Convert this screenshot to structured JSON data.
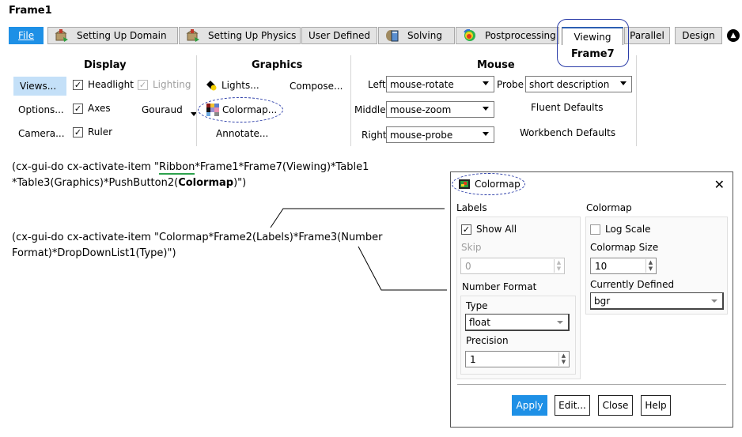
{
  "frame_title": "Frame1",
  "tabs": [
    {
      "label": "File",
      "icon": null
    },
    {
      "label": "Setting Up Domain",
      "icon": "setup-box-icon"
    },
    {
      "label": "Setting Up Physics",
      "icon": "setup-box-icon"
    },
    {
      "label": "User Defined",
      "icon": null
    },
    {
      "label": "Solving",
      "icon": "calculator-icon"
    },
    {
      "label": "Postprocessing",
      "icon": "contour-sphere-icon"
    },
    {
      "label": "Viewing",
      "icon": null,
      "active": true
    },
    {
      "label": "Parallel",
      "icon": null
    },
    {
      "label": "Design",
      "icon": null
    }
  ],
  "annotation_frame7": "Frame7",
  "ribbon": {
    "display": {
      "title": "Display",
      "buttons": [
        "Views...",
        "Options...",
        "Camera..."
      ],
      "checkboxes": [
        {
          "label": "Headlight",
          "checked": true,
          "enabled": true
        },
        {
          "label": "Lighting",
          "checked": true,
          "enabled": false
        },
        {
          "label": "Axes",
          "checked": true,
          "enabled": true
        },
        {
          "label": "Ruler",
          "checked": true,
          "enabled": true
        }
      ],
      "shading": "Gouraud"
    },
    "graphics": {
      "title": "Graphics",
      "buttons": [
        "Lights...",
        "Compose...",
        "Colormap...",
        "Annotate..."
      ]
    },
    "mouse": {
      "title": "Mouse",
      "left_label": "Left",
      "left_value": "mouse-rotate",
      "middle_label": "Middle",
      "middle_value": "mouse-zoom",
      "right_label": "Right",
      "right_value": "mouse-probe",
      "probe_label": "Probe",
      "probe_value": "short description",
      "fluent_defaults": "Fluent Defaults",
      "workbench_defaults": "Workbench Defaults"
    }
  },
  "commands": {
    "cmd1_prefix": "(cx-gui-do cx-activate-item \"",
    "cmd1_ribbon": "Ribbon",
    "cmd1_rest": "*Frame1*Frame7(Viewing)*Table1",
    "cmd1_line2_prefix": "*Table3(Graphics)*PushButton2(",
    "cmd1_bold": "Colormap",
    "cmd1_line2_suffix": ")\")",
    "cmd2_line1": "(cx-gui-do cx-activate-item \"Colormap*Frame2(Labels)*Frame3(Number",
    "cmd2_line2": "Format)*DropDownList1(Type)\")"
  },
  "dialog": {
    "title": "Colormap",
    "labels_group": "Labels",
    "show_all": {
      "label": "Show All",
      "checked": true
    },
    "skip_label": "Skip",
    "skip_value": "0",
    "number_format_label": "Number Format",
    "type_label": "Type",
    "type_value": "float",
    "precision_label": "Precision",
    "precision_value": "1",
    "colormap_group": "Colormap",
    "log_scale": {
      "label": "Log Scale",
      "checked": false
    },
    "colormap_size_label": "Colormap Size",
    "colormap_size_value": "10",
    "currently_defined_label": "Currently Defined",
    "currently_defined_value": "bgr",
    "buttons": {
      "apply": "Apply",
      "edit": "Edit...",
      "close": "Close",
      "help": "Help"
    }
  },
  "colors": {
    "accent": "#1e90e6",
    "annotation": "#2b3da8",
    "underline": "#2ca04c"
  }
}
